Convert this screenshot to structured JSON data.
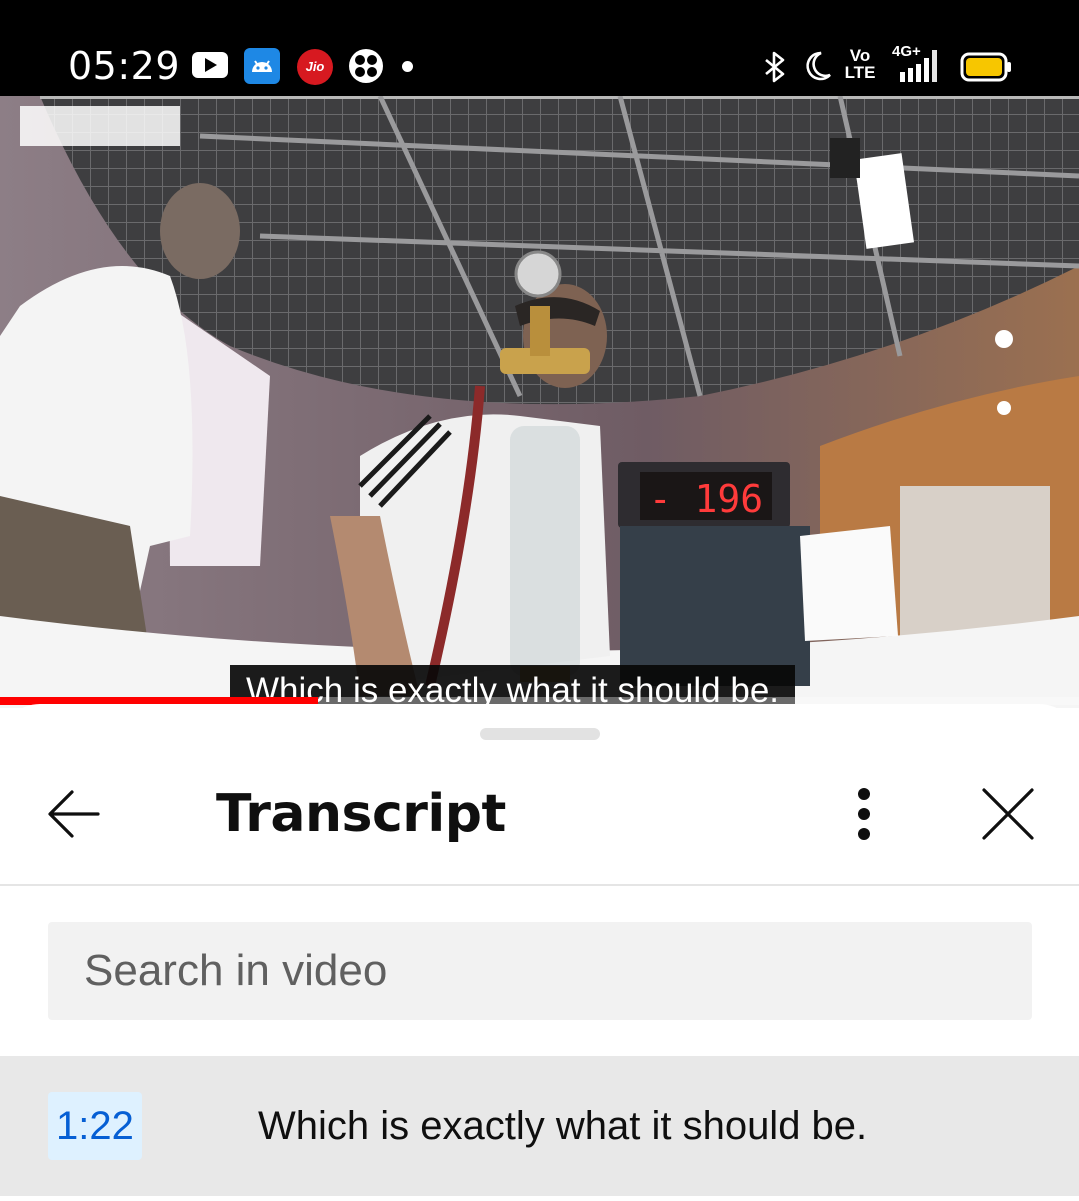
{
  "status_bar": {
    "time": "05:29",
    "left_icons": [
      "youtube-icon",
      "android-icon",
      "jio-icon",
      "game-icon"
    ],
    "jio_label": "Jio",
    "right_icons": [
      "bluetooth-icon",
      "moon-icon",
      "volte-icon",
      "signal-4g-icon",
      "battery-icon"
    ],
    "volte_top": "Vo",
    "volte_bottom": "LTE",
    "network": "4G+"
  },
  "video": {
    "display_reading": "- 196",
    "caption": "Which is exactly what it should be.",
    "progress_fraction": 0.295,
    "progress_color": "#ff0000"
  },
  "transcript_panel": {
    "title": "Transcript",
    "search_placeholder": "Search in video",
    "segments": [
      {
        "time": "1:22",
        "text": "Which is exactly what it should be."
      }
    ]
  }
}
